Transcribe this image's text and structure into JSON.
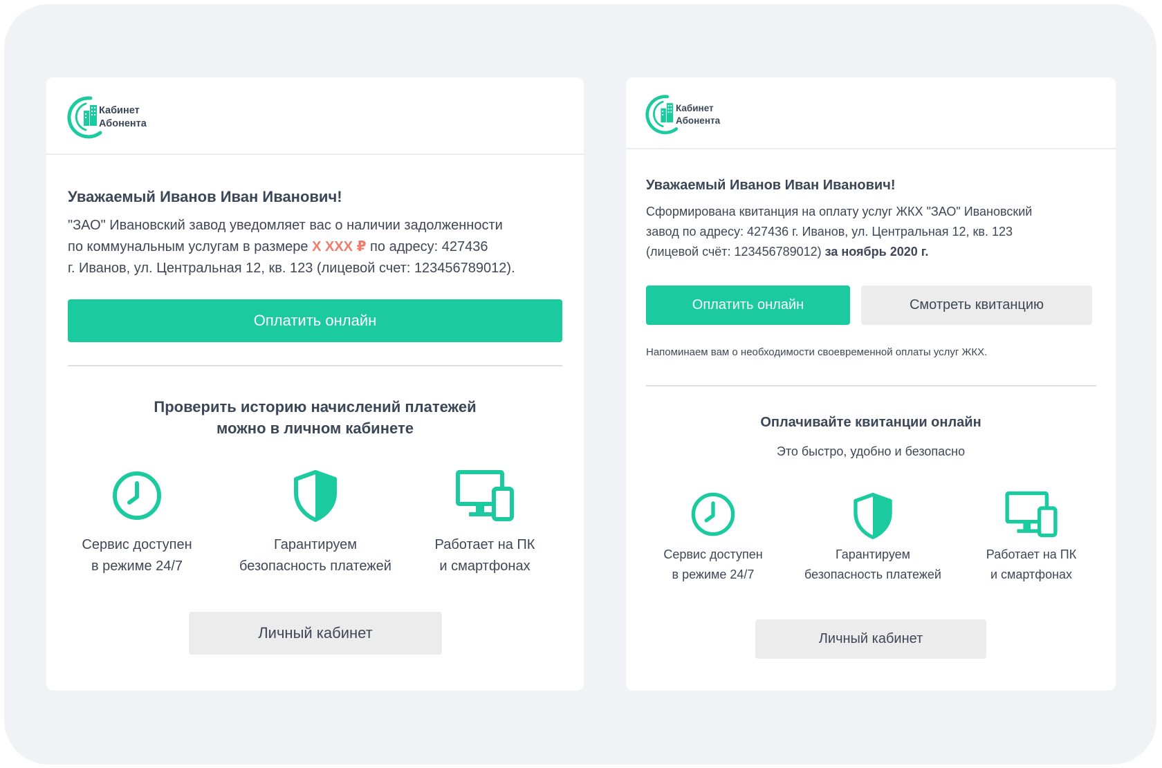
{
  "brand": {
    "logo_line1": "Кабинет",
    "logo_line2": "Абонента",
    "accent_color": "#1ccaa0",
    "amount_color": "#f07b6b"
  },
  "debt_email": {
    "greeting": "Уважаемый Иванов Иван Иванович!",
    "message_line1": "\"ЗАО\" Ивановский завод уведомляет вас о наличии задолженности",
    "message_line2_before": "по коммунальным услугам в размере ",
    "amount": "X XXX ₽",
    "message_line2_after": " по адресу: 427436",
    "message_line3": "г. Иванов, ул. Центральная 12, кв. 123 (лицевой счет: 123456789012).",
    "pay_button": "Оплатить онлайн",
    "section_title_line1": "Проверить историю начислений платежей",
    "section_title_line2": "можно в личном кабинете",
    "features": [
      {
        "icon": "clock-icon",
        "line1": "Сервис доступен",
        "line2": "в режиме 24/7"
      },
      {
        "icon": "shield-icon",
        "line1": "Гарантируем",
        "line2": "безопасность платежей"
      },
      {
        "icon": "devices-icon",
        "line1": "Работает на ПК",
        "line2": "и смартфонах"
      }
    ],
    "cabinet_button": "Личный кабинет"
  },
  "invoice_email": {
    "greeting": "Уважаемый Иванов Иван Иванович!",
    "message_line1": "Сформирована квитанция на оплату услуг ЖКХ \"ЗАО\" Ивановский",
    "message_line2": "завод по адресу: 427436 г. Иванов, ул. Центральная 12, кв. 123",
    "message_line3": "(лицевой счёт: 123456789012) ",
    "period": "за ноябрь 2020 г.",
    "pay_button": "Оплатить онлайн",
    "view_button": "Смотреть квитанцию",
    "reminder": "Напоминаем вам о необходимости своевременной оплаты услуг ЖКХ.",
    "section_title": "Оплачивайте квитанции онлайн",
    "section_subtitle": "Это быстро, удобно и безопасно",
    "features": [
      {
        "icon": "clock-icon",
        "line1": "Сервис доступен",
        "line2": "в режиме 24/7"
      },
      {
        "icon": "shield-icon",
        "line1": "Гарантируем",
        "line2": "безопасность платежей"
      },
      {
        "icon": "devices-icon",
        "line1": "Работает на ПК",
        "line2": "и смартфонах"
      }
    ],
    "cabinet_button": "Личный кабинет"
  }
}
